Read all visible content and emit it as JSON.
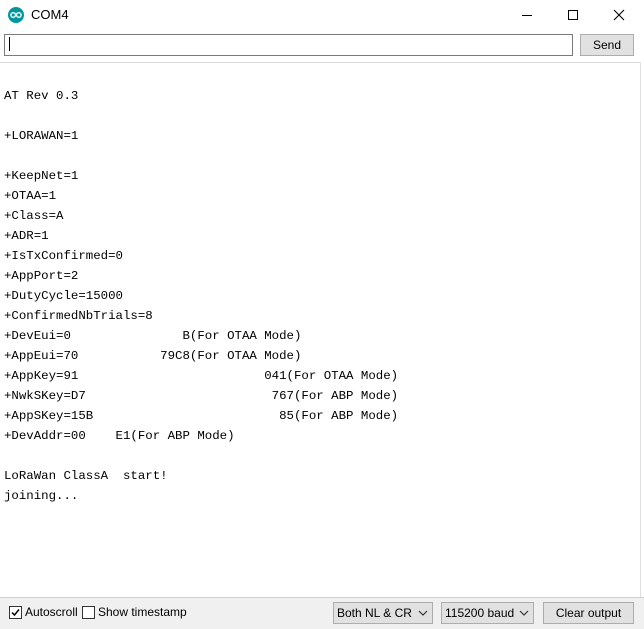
{
  "window": {
    "title": "COM4",
    "icon": "arduino-logo-icon",
    "controls": [
      "minimize-icon",
      "maximize-icon",
      "close-icon"
    ]
  },
  "input": {
    "value": "",
    "placeholder": "",
    "send_label": "Send"
  },
  "output": {
    "lines": [
      "AT Rev 0.3",
      "+LORAWAN=1",
      "+KeepNet=1",
      "+OTAA=1",
      "+Class=A",
      "+ADR=1",
      "+IsTxConfirmed=0",
      "+AppPort=2",
      "+DutyCycle=15000",
      "+ConfirmedNbTrials=8",
      "+DevEui=0               B(For OTAA Mode)",
      "+AppEui=70           79C8(For OTAA Mode)",
      "+AppKey=91                         041(For OTAA Mode)",
      "+NwkSKey=D7                         767(For ABP Mode)",
      "+AppSKey=15B                         85(For ABP Mode)",
      "+DevAddr=00    E1(For ABP Mode)",
      "LoRaWan ClassA  start!",
      "joining..."
    ]
  },
  "status": {
    "autoscroll": {
      "label": "Autoscroll",
      "checked": true
    },
    "timestamp": {
      "label": "Show timestamp",
      "checked": false
    },
    "line_ending": "Both NL & CR",
    "baud": "115200 baud",
    "clear_label": "Clear output"
  }
}
